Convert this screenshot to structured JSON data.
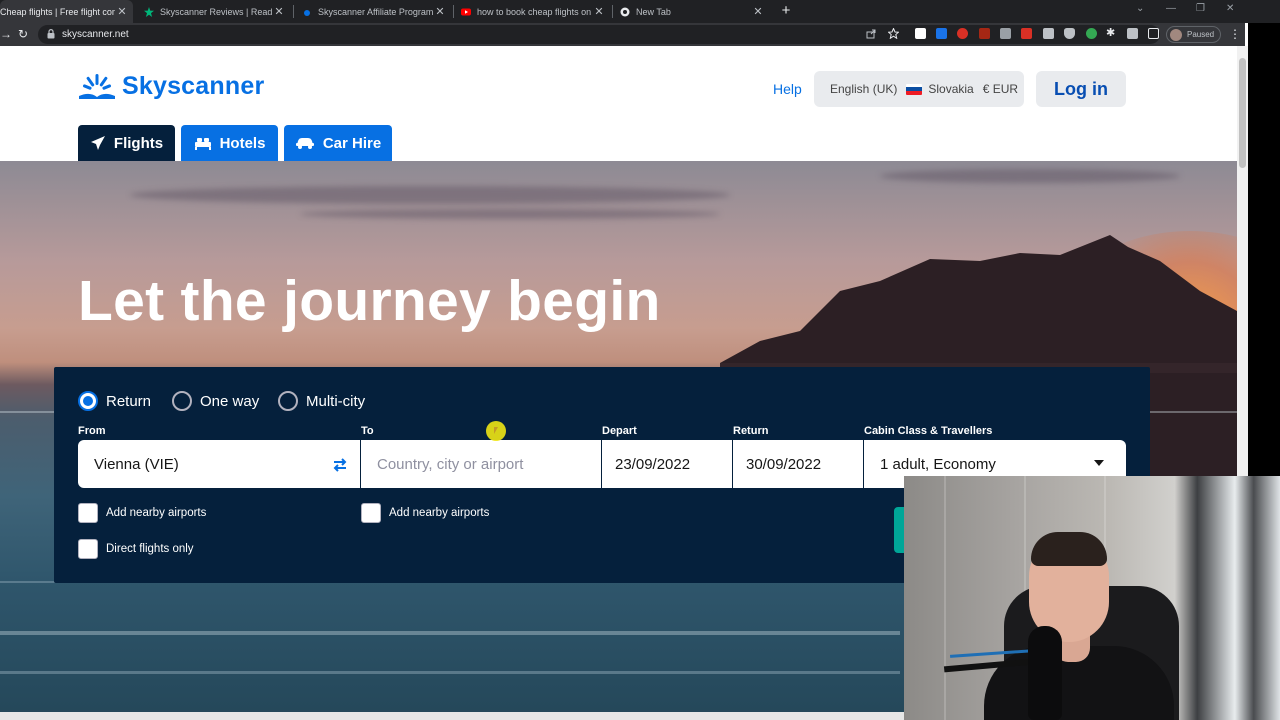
{
  "browser": {
    "tabs": [
      {
        "title": "Cheap flights | Free flight compa",
        "active": true
      },
      {
        "title": "Skyscanner Reviews | Read Custo",
        "active": false
      },
      {
        "title": "Skyscanner Affiliate Programme",
        "active": false
      },
      {
        "title": "how to book cheap flights on sk",
        "active": false
      },
      {
        "title": "New Tab",
        "active": false
      }
    ],
    "tab_close": "✕",
    "new_tab": "+",
    "url": "skyscanner.net",
    "profile_status": "Paused"
  },
  "header": {
    "logo_text": "Skyscanner",
    "help": "Help",
    "language": "English (UK)",
    "country": "Slovakia",
    "currency": "€ EUR",
    "login": "Log in"
  },
  "nav_tabs": [
    {
      "label": "Flights",
      "icon": "plane-icon",
      "active": true
    },
    {
      "label": "Hotels",
      "icon": "bed-icon",
      "active": false
    },
    {
      "label": "Car Hire",
      "icon": "car-icon",
      "active": false
    }
  ],
  "hero": {
    "title": "Let the journey begin"
  },
  "search": {
    "trip_types": [
      {
        "label": "Return",
        "selected": true
      },
      {
        "label": "One way",
        "selected": false
      },
      {
        "label": "Multi-city",
        "selected": false
      }
    ],
    "from_label": "From",
    "from_value": "Vienna (VIE)",
    "to_label": "To",
    "to_placeholder": "Country, city or airport",
    "depart_label": "Depart",
    "depart_value": "23/09/2022",
    "return_label": "Return",
    "return_value": "30/09/2022",
    "cabin_label": "Cabin Class & Travellers",
    "cabin_value": "1 adult, Economy",
    "nearby_from": "Add nearby airports",
    "nearby_to": "Add nearby airports",
    "direct_only": "Direct flights only"
  },
  "colors": {
    "brand_blue": "#0770e3",
    "dark_navy": "#05203c",
    "search_green": "#00a698"
  }
}
